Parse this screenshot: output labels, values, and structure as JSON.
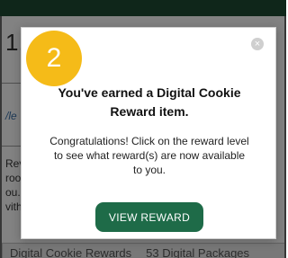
{
  "background": {
    "step_number": "1.",
    "link_fragment": "/le",
    "paragraph_lines": [
      "Rev",
      "roo",
      "ou.",
      "vith"
    ],
    "bottom_bar": {
      "left_label": "Digital Cookie Rewards",
      "right_label": "53 Digital Packages"
    }
  },
  "modal": {
    "step_badge": "2",
    "close_glyph": "×",
    "title": "You've earned a Digital Cookie Reward item.",
    "body": "Congratulations! Click on the reward level to see what reward(s) are now available to you.",
    "button_label": "VIEW REWARD"
  },
  "colors": {
    "badge": "#f5bb18",
    "button": "#1e6b48",
    "top_bar": "#1e4a33"
  }
}
